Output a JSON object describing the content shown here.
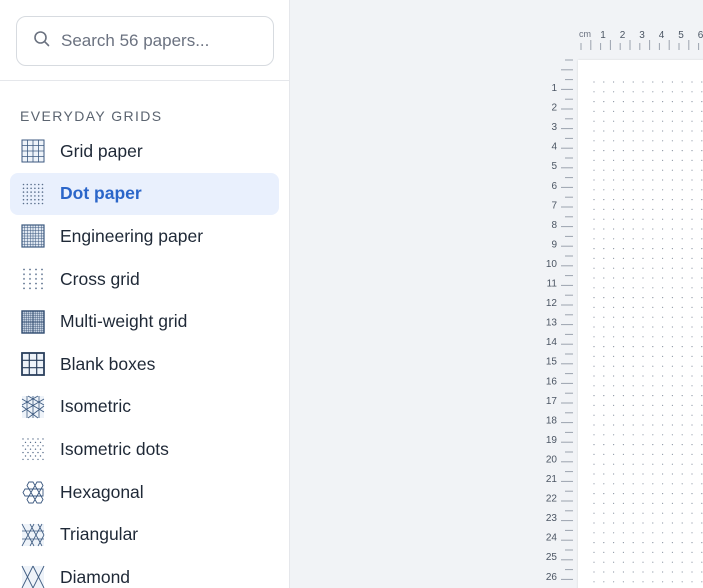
{
  "search": {
    "placeholder": "Search 56 papers..."
  },
  "sidebar": {
    "section_title": "EVERYDAY GRIDS",
    "items": [
      {
        "label": "Grid paper",
        "icon": "grid-icon"
      },
      {
        "label": "Dot paper",
        "icon": "dot-grid-icon",
        "active": true
      },
      {
        "label": "Engineering paper",
        "icon": "engineering-grid-icon"
      },
      {
        "label": "Cross grid",
        "icon": "cross-grid-icon"
      },
      {
        "label": "Multi-weight grid",
        "icon": "multi-weight-grid-icon"
      },
      {
        "label": "Blank boxes",
        "icon": "blank-boxes-icon"
      },
      {
        "label": "Isometric",
        "icon": "isometric-icon"
      },
      {
        "label": "Isometric dots",
        "icon": "isometric-dots-icon"
      },
      {
        "label": "Hexagonal",
        "icon": "hexagon-icon"
      },
      {
        "label": "Triangular",
        "icon": "triangle-grid-icon"
      },
      {
        "label": "Diamond",
        "icon": "diamond-grid-icon"
      }
    ]
  },
  "ruler": {
    "unit": "cm",
    "h_numbers": [
      "1",
      "2",
      "3",
      "4",
      "5",
      "6"
    ],
    "v_numbers": [
      "1",
      "2",
      "3",
      "4",
      "5",
      "6",
      "7",
      "8",
      "9",
      "10",
      "11",
      "12",
      "13",
      "14",
      "15",
      "16",
      "17",
      "18",
      "19",
      "20",
      "21",
      "22",
      "23",
      "24",
      "25",
      "26"
    ]
  },
  "colors": {
    "accent": "#2b66c9",
    "active_bg": "#e9f0fd",
    "icon": "#3d5a80"
  }
}
